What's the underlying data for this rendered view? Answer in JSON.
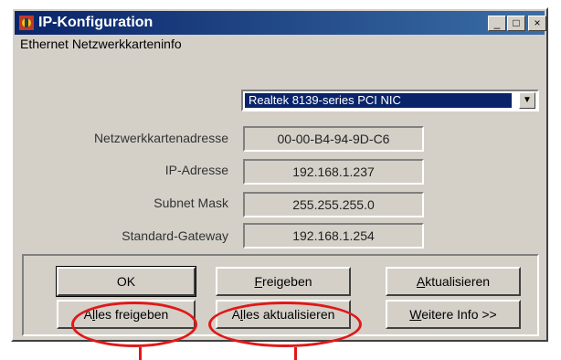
{
  "window": {
    "title": "IP-Konfiguration",
    "minimize_label": "_",
    "maximize_label": "□",
    "close_label": "×"
  },
  "group_label": "Ethernet Netzwerkkarteninfo",
  "adapter": {
    "selected": "Realtek 8139-series PCI NIC",
    "arrow": "▼"
  },
  "fields": [
    {
      "label": "Netzwerkkartenadresse",
      "value": "00-00-B4-94-9D-C6"
    },
    {
      "label": "IP-Adresse",
      "value": "192.168.1.237"
    },
    {
      "label": "Subnet Mask",
      "value": "255.255.255.0"
    },
    {
      "label": "Standard-Gateway",
      "value": "192.168.1.254"
    }
  ],
  "buttons": {
    "ok": "OK",
    "release_prefix": "",
    "release_mnemonic": "F",
    "release_suffix": "reigeben",
    "renew_prefix": "",
    "renew_mnemonic": "A",
    "renew_suffix": "ktualisieren",
    "release_all_prefix": "A",
    "release_all_mnemonic": "l",
    "release_all_suffix": "les freigeben",
    "renew_all_prefix": "A",
    "renew_all_mnemonic": "l",
    "renew_all_suffix": "les aktualisieren",
    "more_info_prefix": "",
    "more_info_mnemonic": "W",
    "more_info_suffix": "eitere Info >>"
  },
  "annotation_color": "#e01818"
}
